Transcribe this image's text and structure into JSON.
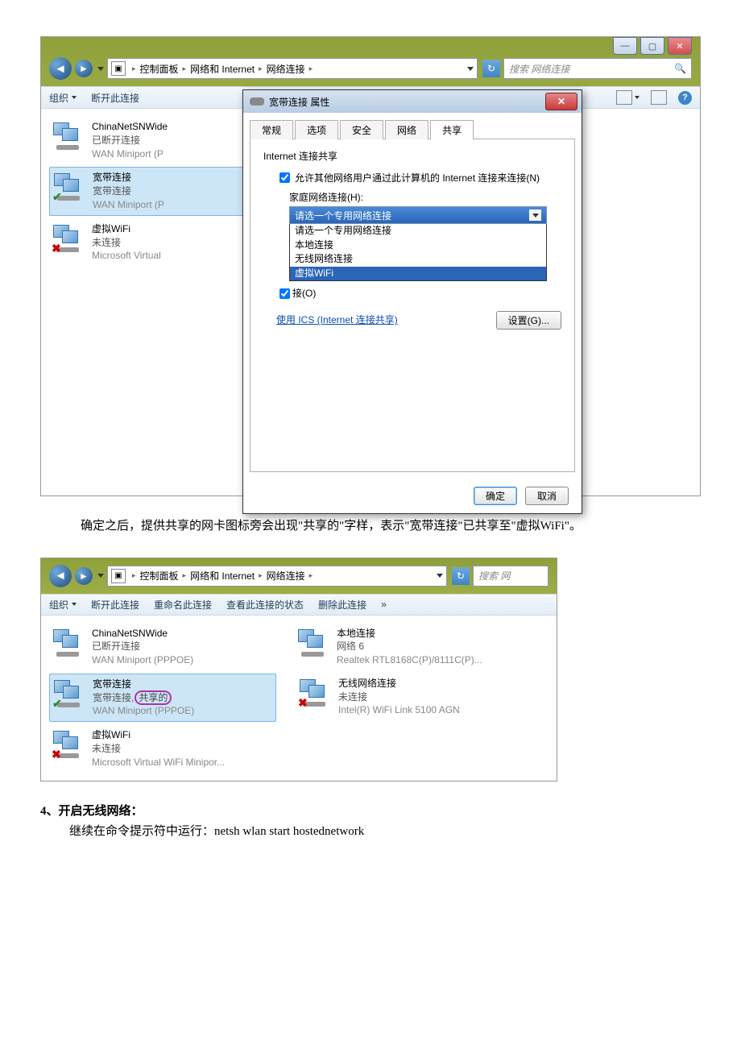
{
  "fig1": {
    "win_btn_min": "—",
    "win_btn_max": "▢",
    "win_btn_close": "✕",
    "addr_segments": [
      "控制面板",
      "网络和 Internet",
      "网络连接"
    ],
    "search_placeholder": "搜索 网络连接",
    "toolbar": {
      "organize": "组织",
      "disconnect": "断开此连接"
    },
    "connections": [
      {
        "name": "ChinaNetSNWide",
        "status": "已断开连接",
        "device": "WAN Miniport (P"
      },
      {
        "name": "宽带连接",
        "status": "宽带连接",
        "device": "WAN Miniport (P"
      },
      {
        "name": "虚拟WiFi",
        "status": "未连接",
        "device": "Microsoft Virtual"
      }
    ],
    "dialog": {
      "title": "宽带连接 属性",
      "tabs": [
        "常规",
        "选项",
        "安全",
        "网络",
        "共享"
      ],
      "section": "Internet 连接共享",
      "chk_allow": "允许其他网络用户通过此计算机的 Internet 连接来连接(N)",
      "home_label": "家庭网络连接(H):",
      "combo_selected": "请选一个专用网络连接",
      "combo_opts": [
        "请选一个专用网络连接",
        "本地连接",
        "无线网络连接",
        "虚拟WiFi"
      ],
      "chk_below_partial": "接(O)",
      "ics_link": "使用 ICS (Internet 连接共享)",
      "settings_btn": "设置(G)...",
      "ok": "确定",
      "cancel": "取消"
    }
  },
  "para1": "确定之后，提供共享的网卡图标旁会出现\"共享的\"字样，表示\"宽带连接\"已共享至\"虚拟WiFi\"。",
  "fig2": {
    "addr_segments": [
      "控制面板",
      "网络和 Internet",
      "网络连接"
    ],
    "search_placeholder": "搜索 网",
    "toolbar": {
      "organize": "组织",
      "disconnect": "断开此连接",
      "rename": "重命名此连接",
      "viewstatus": "查看此连接的状态",
      "delete": "删除此连接",
      "more": "»"
    },
    "connections": [
      {
        "name": "ChinaNetSNWide",
        "status": "已断开连接",
        "device": "WAN Miniport (PPPOE)"
      },
      {
        "name": "本地连接",
        "status": "网络 6",
        "device": "Realtek RTL8168C(P)/8111C(P)..."
      },
      {
        "name": "宽带连接",
        "status_prefix": "宽带连接,",
        "shared_badge": "共享的",
        "device": "WAN Miniport (PPPOE)"
      },
      {
        "name": "无线网络连接",
        "status": "未连接",
        "device": "Intel(R) WiFi Link 5100 AGN"
      },
      {
        "name": "虚拟WiFi",
        "status": "未连接",
        "device": "Microsoft Virtual WiFi Minipor..."
      }
    ]
  },
  "section4_head": "4、开启无线网络：",
  "section4_body": "继续在命令提示符中运行：netsh wlan start hostednetwork"
}
